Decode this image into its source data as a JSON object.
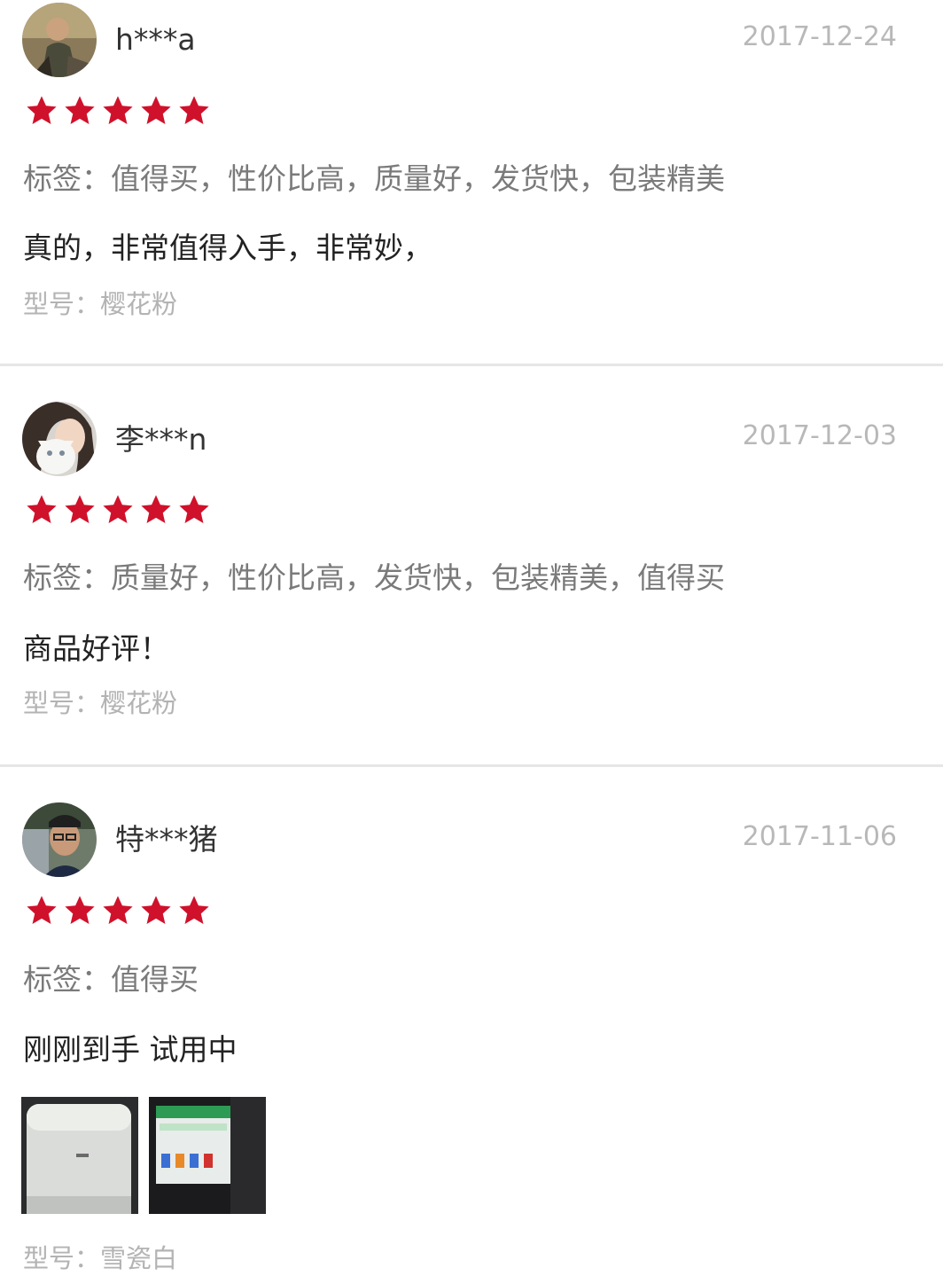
{
  "colors": {
    "star": "#d0112b",
    "date": "#b8b8b8",
    "tags": "#7a7a7a",
    "model": "#b3b3b3",
    "divider": "#e6e6e6"
  },
  "reviews": [
    {
      "username": "h***a",
      "date": "2017-12-24",
      "rating": 5,
      "tags": "标签：值得买，性价比高，质量好，发货快，包装精美",
      "content": "真的，非常值得入手，非常妙，",
      "model": "型号：樱花粉"
    },
    {
      "username": "李***n",
      "date": "2017-12-03",
      "rating": 5,
      "tags": "标签：质量好，性价比高，发货快，包装精美，值得买",
      "content": "商品好评！",
      "model": "型号：樱花粉"
    },
    {
      "username": "特***猪",
      "date": "2017-11-06",
      "rating": 5,
      "tags": "标签：值得买",
      "content": "刚刚到手 试用中",
      "model": "型号：雪瓷白",
      "photos": [
        "device-photo",
        "screen-photo"
      ]
    }
  ]
}
